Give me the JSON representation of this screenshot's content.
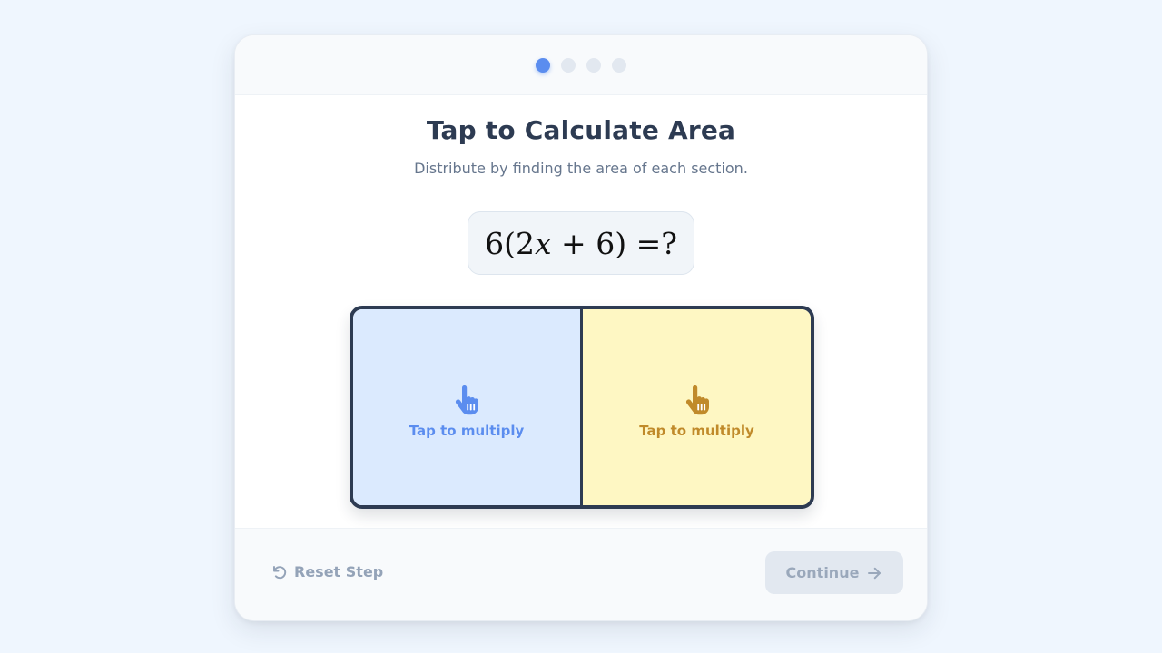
{
  "progress": {
    "total_steps": 4,
    "current_step": 1
  },
  "title": "Tap to Calculate Area",
  "subtitle": "Distribute by finding the area of each section.",
  "equation": {
    "coefficient": "6",
    "open": "(",
    "term1": "2",
    "var": "x",
    "op": " + ",
    "term2": "6",
    "close": ")",
    "equals": " =",
    "unknown": "?"
  },
  "area_model": {
    "left": {
      "label": "Tap to multiply",
      "color": "#dbeafe",
      "accent": "#5b8def",
      "icon": "pointer-hand-icon"
    },
    "right": {
      "label": "Tap to multiply",
      "color": "#fef7c3",
      "accent": "#c08a2a",
      "icon": "pointer-hand-icon"
    }
  },
  "footer": {
    "reset_label": "Reset Step",
    "reset_icon": "undo-icon",
    "continue_label": "Continue",
    "continue_icon": "arrow-right-icon",
    "continue_enabled": false
  },
  "colors": {
    "accent": "#5b8def",
    "border": "#2d3b52",
    "background": "#eff6fe"
  }
}
